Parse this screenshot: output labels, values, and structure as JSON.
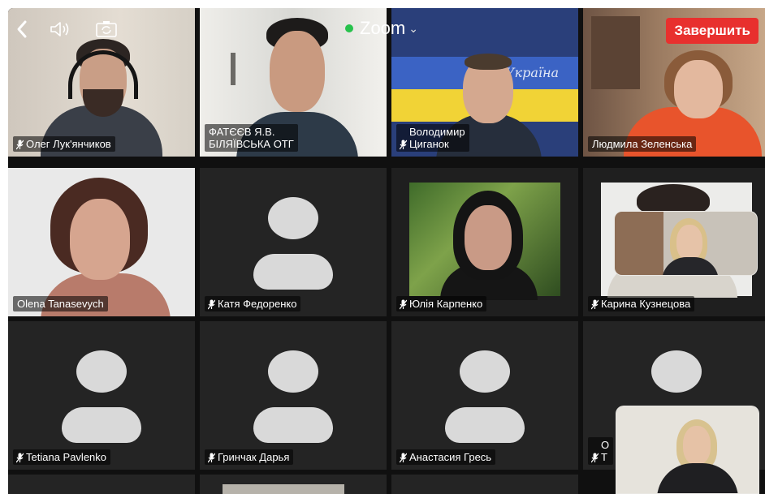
{
  "topbar": {
    "title": "Zoom",
    "title_caret": "⌄",
    "end_button_label": "Завершить",
    "icons": [
      "back-icon",
      "speaker-icon",
      "camera-switch-icon"
    ]
  },
  "participants": [
    {
      "name": "Олег Лук'янчиков",
      "muted_icon": true,
      "video": true
    },
    {
      "name": "ФАТЄЄВ Я.В.\nБІЛЯЇВСЬКА ОТГ",
      "muted_icon": false,
      "video": true
    },
    {
      "name": "Володимир\nЦиганок",
      "muted_icon": true,
      "video": true
    },
    {
      "name": "Людмила Зеленська",
      "muted_icon": false,
      "video": true
    },
    {
      "name": "Olena Tanasevych",
      "muted_icon": false,
      "video": true
    },
    {
      "name": "Катя Федоренко",
      "muted_icon": true,
      "video": false
    },
    {
      "name": "Юлія Карпенко",
      "muted_icon": true,
      "video": true
    },
    {
      "name": "Карина Кузнецова",
      "muted_icon": true,
      "video": true
    },
    {
      "name": "Tetiana Pavlenko",
      "muted_icon": true,
      "video": false
    },
    {
      "name": "Гринчак Дарья",
      "muted_icon": true,
      "video": false
    },
    {
      "name": "Анастасия Гресь",
      "muted_icon": true,
      "video": false
    },
    {
      "name": "О\nТ",
      "muted_icon": true,
      "video": false
    }
  ],
  "colors": {
    "end_button": "#e8302e",
    "zoom_status_dot": "#27c24c",
    "tile_background": "#242424",
    "avatar_placeholder": "#d9d9d9"
  }
}
